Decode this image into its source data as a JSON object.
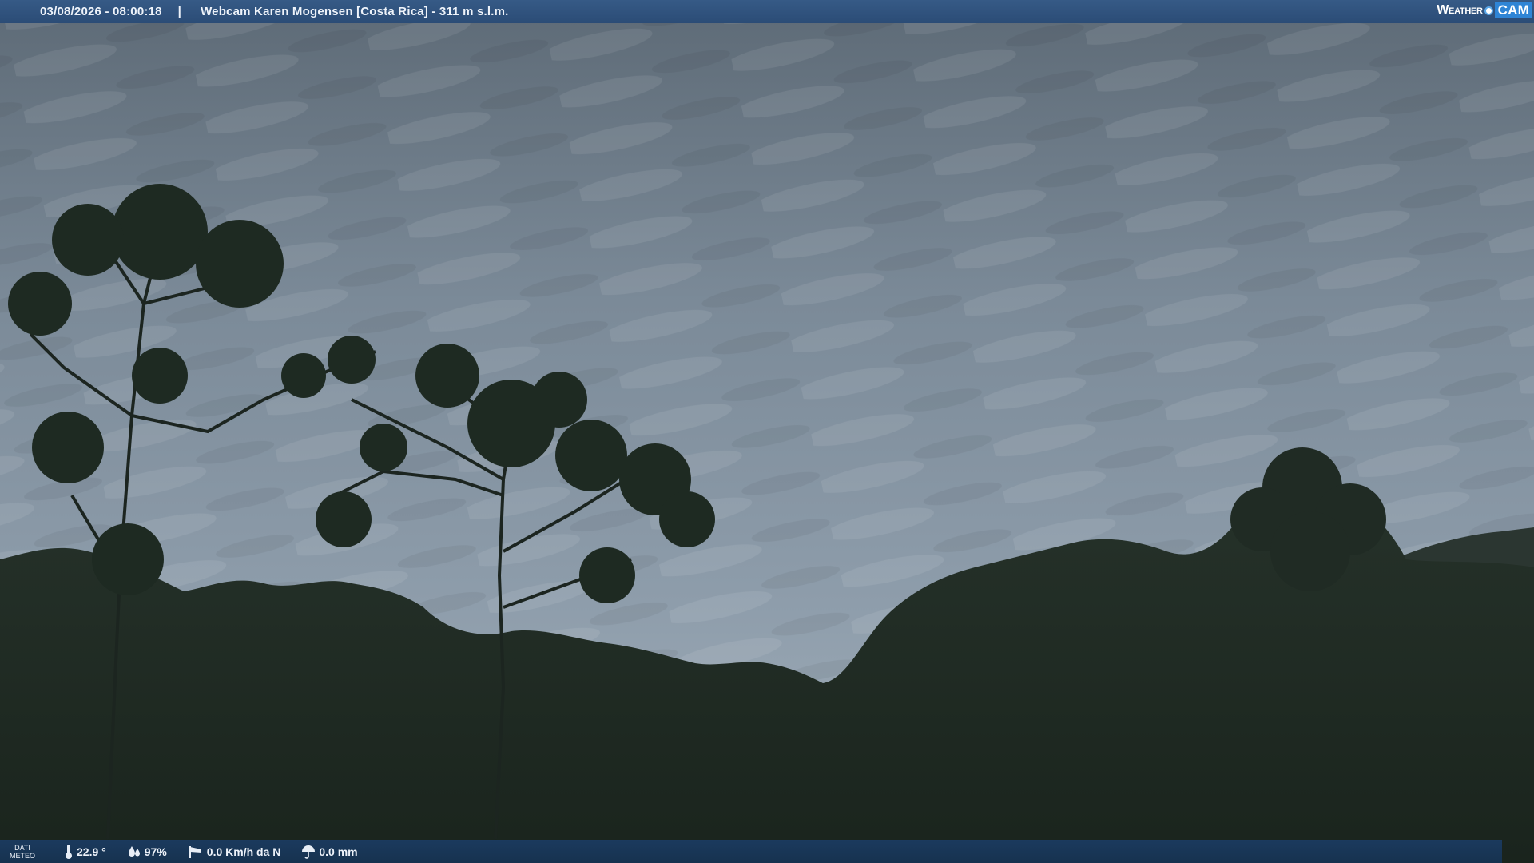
{
  "overlay": {
    "timestamp": "03/08/2026 - 08:00:18",
    "separator": "|",
    "camera_title": "Webcam Karen Mogensen [Costa Rica]  - 311 m s.l.m.",
    "logo": {
      "weather": "Weather",
      "cam": "CAM"
    }
  },
  "weather": {
    "section_label_line1": "DATI",
    "section_label_line2": "METEO",
    "temperature": "22.9 °",
    "humidity": "97%",
    "wind": "0.0 Km/h da N",
    "rain": "0.0 mm"
  },
  "icons": {
    "temperature": "thermometer-icon",
    "humidity": "droplets-icon",
    "wind": "windsock-icon",
    "rain": "umbrella-icon"
  },
  "colors": {
    "sky": "#7d8d9b",
    "forest": "#1f2a22",
    "bar_top": "#2f5380",
    "bar_bottom": "#18344f",
    "logo_accent": "#2f85d6"
  }
}
